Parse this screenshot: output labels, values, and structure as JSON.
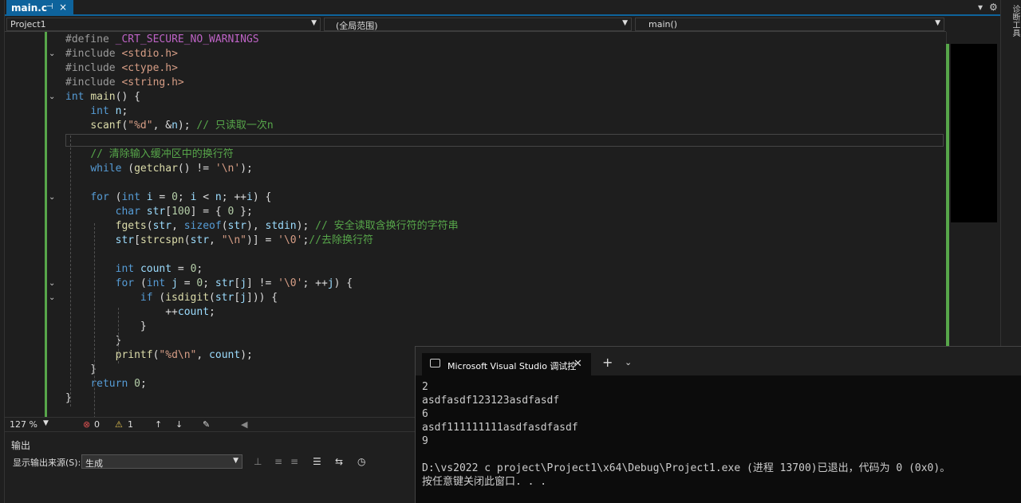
{
  "tab": {
    "title": "main.c",
    "pin": "⊣",
    "close": "×"
  },
  "topright": {
    "dropdown": "▾",
    "settings": "⚙"
  },
  "rightbar": {
    "label": "诊断工具"
  },
  "nav": {
    "project": "Project1",
    "scope": "(全局范围)",
    "member": "main()"
  },
  "code": [
    {
      "fold": "",
      "parts": [
        [
          "pp",
          "#define "
        ],
        [
          "mac",
          "_CRT_SECURE_NO_WARNINGS"
        ]
      ]
    },
    {
      "fold": "v",
      "parts": [
        [
          "pp",
          "#include "
        ],
        [
          "inc",
          "<stdio.h>"
        ]
      ]
    },
    {
      "fold": "",
      "parts": [
        [
          "pp",
          "#include "
        ],
        [
          "inc",
          "<ctype.h>"
        ]
      ]
    },
    {
      "fold": "",
      "parts": [
        [
          "pp",
          "#include "
        ],
        [
          "inc",
          "<string.h>"
        ]
      ]
    },
    {
      "fold": "v",
      "parts": [
        [
          "kw",
          "int "
        ],
        [
          "fn",
          "main"
        ],
        [
          "",
          "() {"
        ]
      ]
    },
    {
      "fold": "",
      "parts": [
        [
          "",
          "    "
        ],
        [
          "kw",
          "int "
        ],
        [
          "var",
          "n"
        ],
        [
          "",
          ";"
        ]
      ]
    },
    {
      "fold": "",
      "parts": [
        [
          "",
          "    "
        ],
        [
          "fn",
          "scanf"
        ],
        [
          "",
          "("
        ],
        [
          "str",
          "\"%d\""
        ],
        [
          "",
          ", &"
        ],
        [
          "var",
          "n"
        ],
        [
          "",
          "); "
        ],
        [
          "cm",
          "// 只读取一次n"
        ]
      ]
    },
    {
      "fold": "",
      "parts": [
        [
          "",
          ""
        ]
      ]
    },
    {
      "fold": "",
      "parts": [
        [
          "",
          "    "
        ],
        [
          "cm",
          "// 清除输入缓冲区中的换行符"
        ]
      ]
    },
    {
      "fold": "",
      "parts": [
        [
          "",
          "    "
        ],
        [
          "kw",
          "while "
        ],
        [
          "",
          "("
        ],
        [
          "fn",
          "getchar"
        ],
        [
          "",
          "() != "
        ],
        [
          "str",
          "'\\n'"
        ],
        [
          "",
          ");"
        ]
      ]
    },
    {
      "fold": "",
      "parts": [
        [
          "",
          ""
        ]
      ]
    },
    {
      "fold": "v",
      "parts": [
        [
          "",
          "    "
        ],
        [
          "kw",
          "for "
        ],
        [
          "",
          "("
        ],
        [
          "kw",
          "int "
        ],
        [
          "var",
          "i"
        ],
        [
          "",
          " = "
        ],
        [
          "num",
          "0"
        ],
        [
          "",
          "; "
        ],
        [
          "var",
          "i"
        ],
        [
          "",
          " < "
        ],
        [
          "var",
          "n"
        ],
        [
          "",
          "; ++"
        ],
        [
          "var",
          "i"
        ],
        [
          "",
          ") {"
        ]
      ]
    },
    {
      "fold": "",
      "parts": [
        [
          "",
          "        "
        ],
        [
          "kw",
          "char "
        ],
        [
          "var",
          "str"
        ],
        [
          "",
          "["
        ],
        [
          "num",
          "100"
        ],
        [
          "",
          "] = { "
        ],
        [
          "num",
          "0"
        ],
        [
          "",
          " };"
        ]
      ]
    },
    {
      "fold": "",
      "parts": [
        [
          "",
          "        "
        ],
        [
          "fn",
          "fgets"
        ],
        [
          "",
          "("
        ],
        [
          "var",
          "str"
        ],
        [
          "",
          ", "
        ],
        [
          "kw",
          "sizeof"
        ],
        [
          "",
          "("
        ],
        [
          "var",
          "str"
        ],
        [
          "",
          "), "
        ],
        [
          "var",
          "stdin"
        ],
        [
          "",
          "); "
        ],
        [
          "cm",
          "// 安全读取含换行符的字符串"
        ]
      ]
    },
    {
      "fold": "",
      "parts": [
        [
          "",
          "        "
        ],
        [
          "var",
          "str"
        ],
        [
          "",
          "["
        ],
        [
          "fn",
          "strcspn"
        ],
        [
          "",
          "("
        ],
        [
          "var",
          "str"
        ],
        [
          "",
          ", "
        ],
        [
          "str",
          "\"\\n\""
        ],
        [
          "",
          ")] = "
        ],
        [
          "str",
          "'\\0'"
        ],
        [
          "",
          ";"
        ],
        [
          "cm",
          "//去除换行符"
        ]
      ]
    },
    {
      "fold": "",
      "parts": [
        [
          "",
          ""
        ]
      ]
    },
    {
      "fold": "",
      "parts": [
        [
          "",
          "        "
        ],
        [
          "kw",
          "int "
        ],
        [
          "var",
          "count"
        ],
        [
          "",
          " = "
        ],
        [
          "num",
          "0"
        ],
        [
          "",
          ";"
        ]
      ]
    },
    {
      "fold": "v",
      "parts": [
        [
          "",
          "        "
        ],
        [
          "kw",
          "for "
        ],
        [
          "",
          "("
        ],
        [
          "kw",
          "int "
        ],
        [
          "var",
          "j"
        ],
        [
          "",
          " = "
        ],
        [
          "num",
          "0"
        ],
        [
          "",
          "; "
        ],
        [
          "var",
          "str"
        ],
        [
          "",
          "["
        ],
        [
          "var",
          "j"
        ],
        [
          "",
          "] != "
        ],
        [
          "str",
          "'\\0'"
        ],
        [
          "",
          "; ++"
        ],
        [
          "var",
          "j"
        ],
        [
          "",
          ") {"
        ]
      ]
    },
    {
      "fold": "v",
      "parts": [
        [
          "",
          "            "
        ],
        [
          "kw",
          "if "
        ],
        [
          "",
          "("
        ],
        [
          "fn",
          "isdigit"
        ],
        [
          "",
          "("
        ],
        [
          "var",
          "str"
        ],
        [
          "",
          "["
        ],
        [
          "var",
          "j"
        ],
        [
          "",
          "])) {"
        ]
      ]
    },
    {
      "fold": "",
      "parts": [
        [
          "",
          "                ++"
        ],
        [
          "var",
          "count"
        ],
        [
          "",
          ";"
        ]
      ]
    },
    {
      "fold": "",
      "parts": [
        [
          "",
          "            }"
        ]
      ]
    },
    {
      "fold": "",
      "parts": [
        [
          "",
          "        }"
        ]
      ]
    },
    {
      "fold": "",
      "parts": [
        [
          "",
          "        "
        ],
        [
          "fn",
          "printf"
        ],
        [
          "",
          "("
        ],
        [
          "str",
          "\"%d\\n\""
        ],
        [
          "",
          ", "
        ],
        [
          "var",
          "count"
        ],
        [
          "",
          ");"
        ]
      ]
    },
    {
      "fold": "",
      "parts": [
        [
          "",
          "    }"
        ]
      ]
    },
    {
      "fold": "",
      "parts": [
        [
          "",
          "    "
        ],
        [
          "kw",
          "return "
        ],
        [
          "num",
          "0"
        ],
        [
          "",
          ";"
        ]
      ]
    },
    {
      "fold": "",
      "parts": [
        [
          "",
          "}"
        ]
      ]
    }
  ],
  "status": {
    "zoom": "127 %",
    "errors": "0",
    "warnings": "1"
  },
  "output": {
    "title": "输出",
    "source_label": "显示输出来源(S):",
    "source_value": "生成"
  },
  "terminal": {
    "tab_title": "Microsoft Visual Studio 调试控",
    "lines": [
      "2",
      "asdfasdf123123asdfasdf",
      "6",
      "asdf111111111asdfasdfasdf",
      "9",
      "",
      "D:\\vs2022 c project\\Project1\\x64\\Debug\\Project1.exe (进程 13700)已退出，代码为 0 (0x0)。",
      "按任意键关闭此窗口. . ."
    ]
  },
  "colors": {
    "accent": "#0e639c",
    "gutter": "#57a64a",
    "keyword": "#569cd6",
    "comment": "#57a64a",
    "string": "#d69d85"
  }
}
